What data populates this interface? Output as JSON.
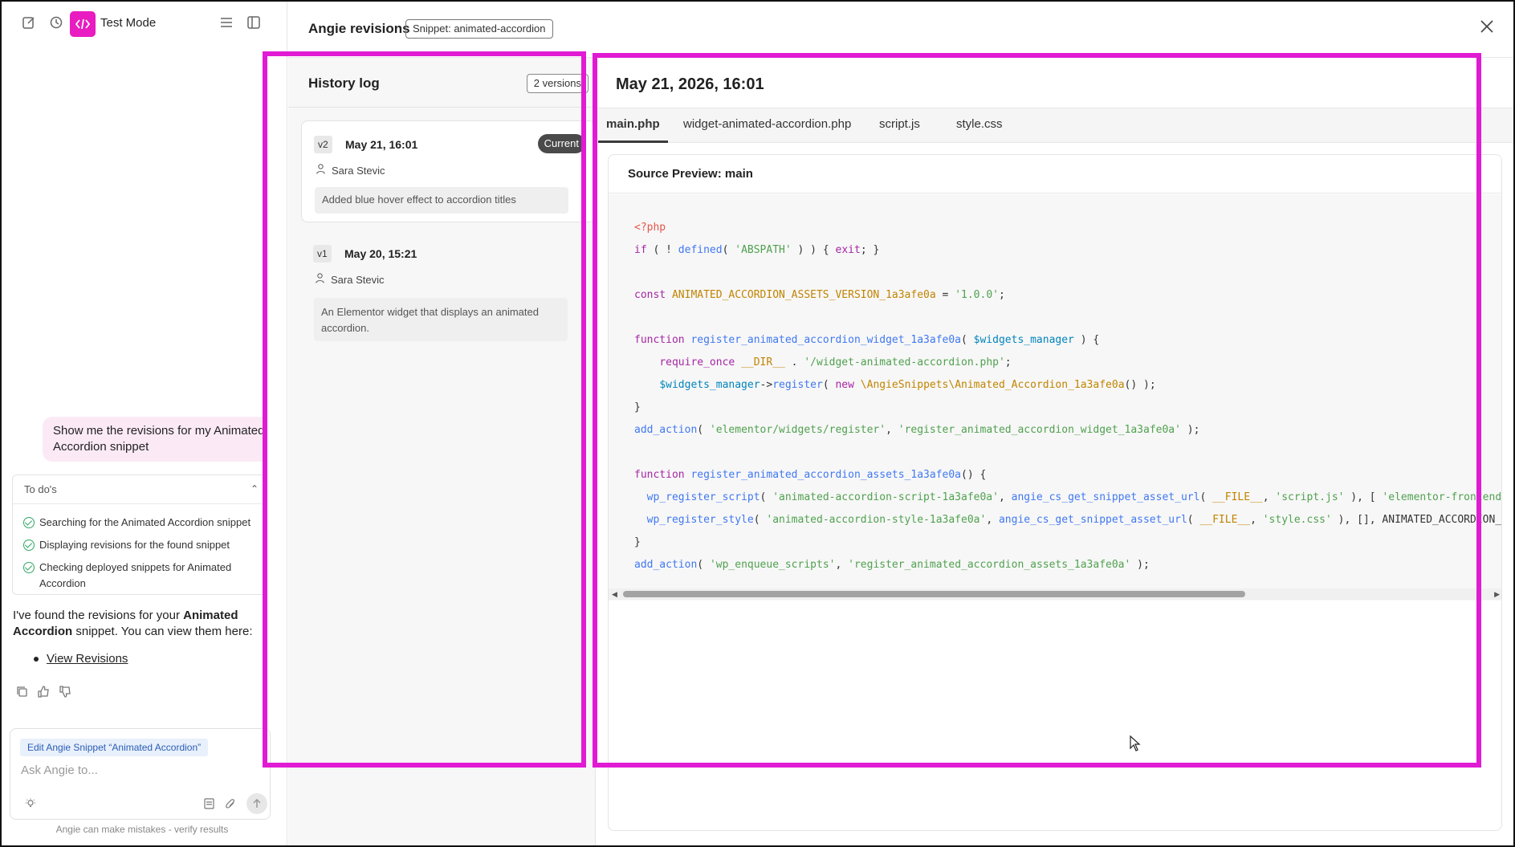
{
  "app": {
    "title": "Test Mode",
    "accent": "#e81cc0"
  },
  "chat": {
    "user_message": "Show me the revisions for my Animated Accordion snippet",
    "todos_title": "To do's",
    "todos": [
      {
        "label": "Searching for the Animated Accordion snippet",
        "status": "done"
      },
      {
        "label": "Displaying revisions for the found snippet",
        "status": "done"
      },
      {
        "label": "Checking deployed snippets for Animated Accordion",
        "status": "done"
      }
    ],
    "assistant_intro": "I've found the revisions for your ",
    "assistant_bold": "Animated Accordion",
    "assistant_tail": " snippet. You can view them here:",
    "assistant_link": "View Revisions",
    "context_chip": "Edit Angie Snippet “Animated Accordion”",
    "input_placeholder": "Ask Angie to...",
    "disclaimer": "Angie can make mistakes - verify results"
  },
  "revisions": {
    "title": "Angie revisions",
    "snippet_badge": "Snippet: animated-accordion",
    "history_title": "History log",
    "version_count": "2 versions",
    "versions": [
      {
        "tag": "v2",
        "date": "May 21, 16:01",
        "author": "Sara Stevic",
        "note": "Added blue hover effect to accordion titles",
        "current_label": "Current"
      },
      {
        "tag": "v1",
        "date": "May 20, 15:21",
        "author": "Sara Stevic",
        "note": "An Elementor widget that displays an animated accordion."
      }
    ]
  },
  "preview": {
    "date": "May 21, 2026, 16:01",
    "tabs": [
      "main.php",
      "widget-animated-accordion.php",
      "script.js",
      "style.css"
    ],
    "active_tab": "main.php",
    "source_title": "Source Preview: main"
  },
  "highlight_color": "#e01bd3"
}
